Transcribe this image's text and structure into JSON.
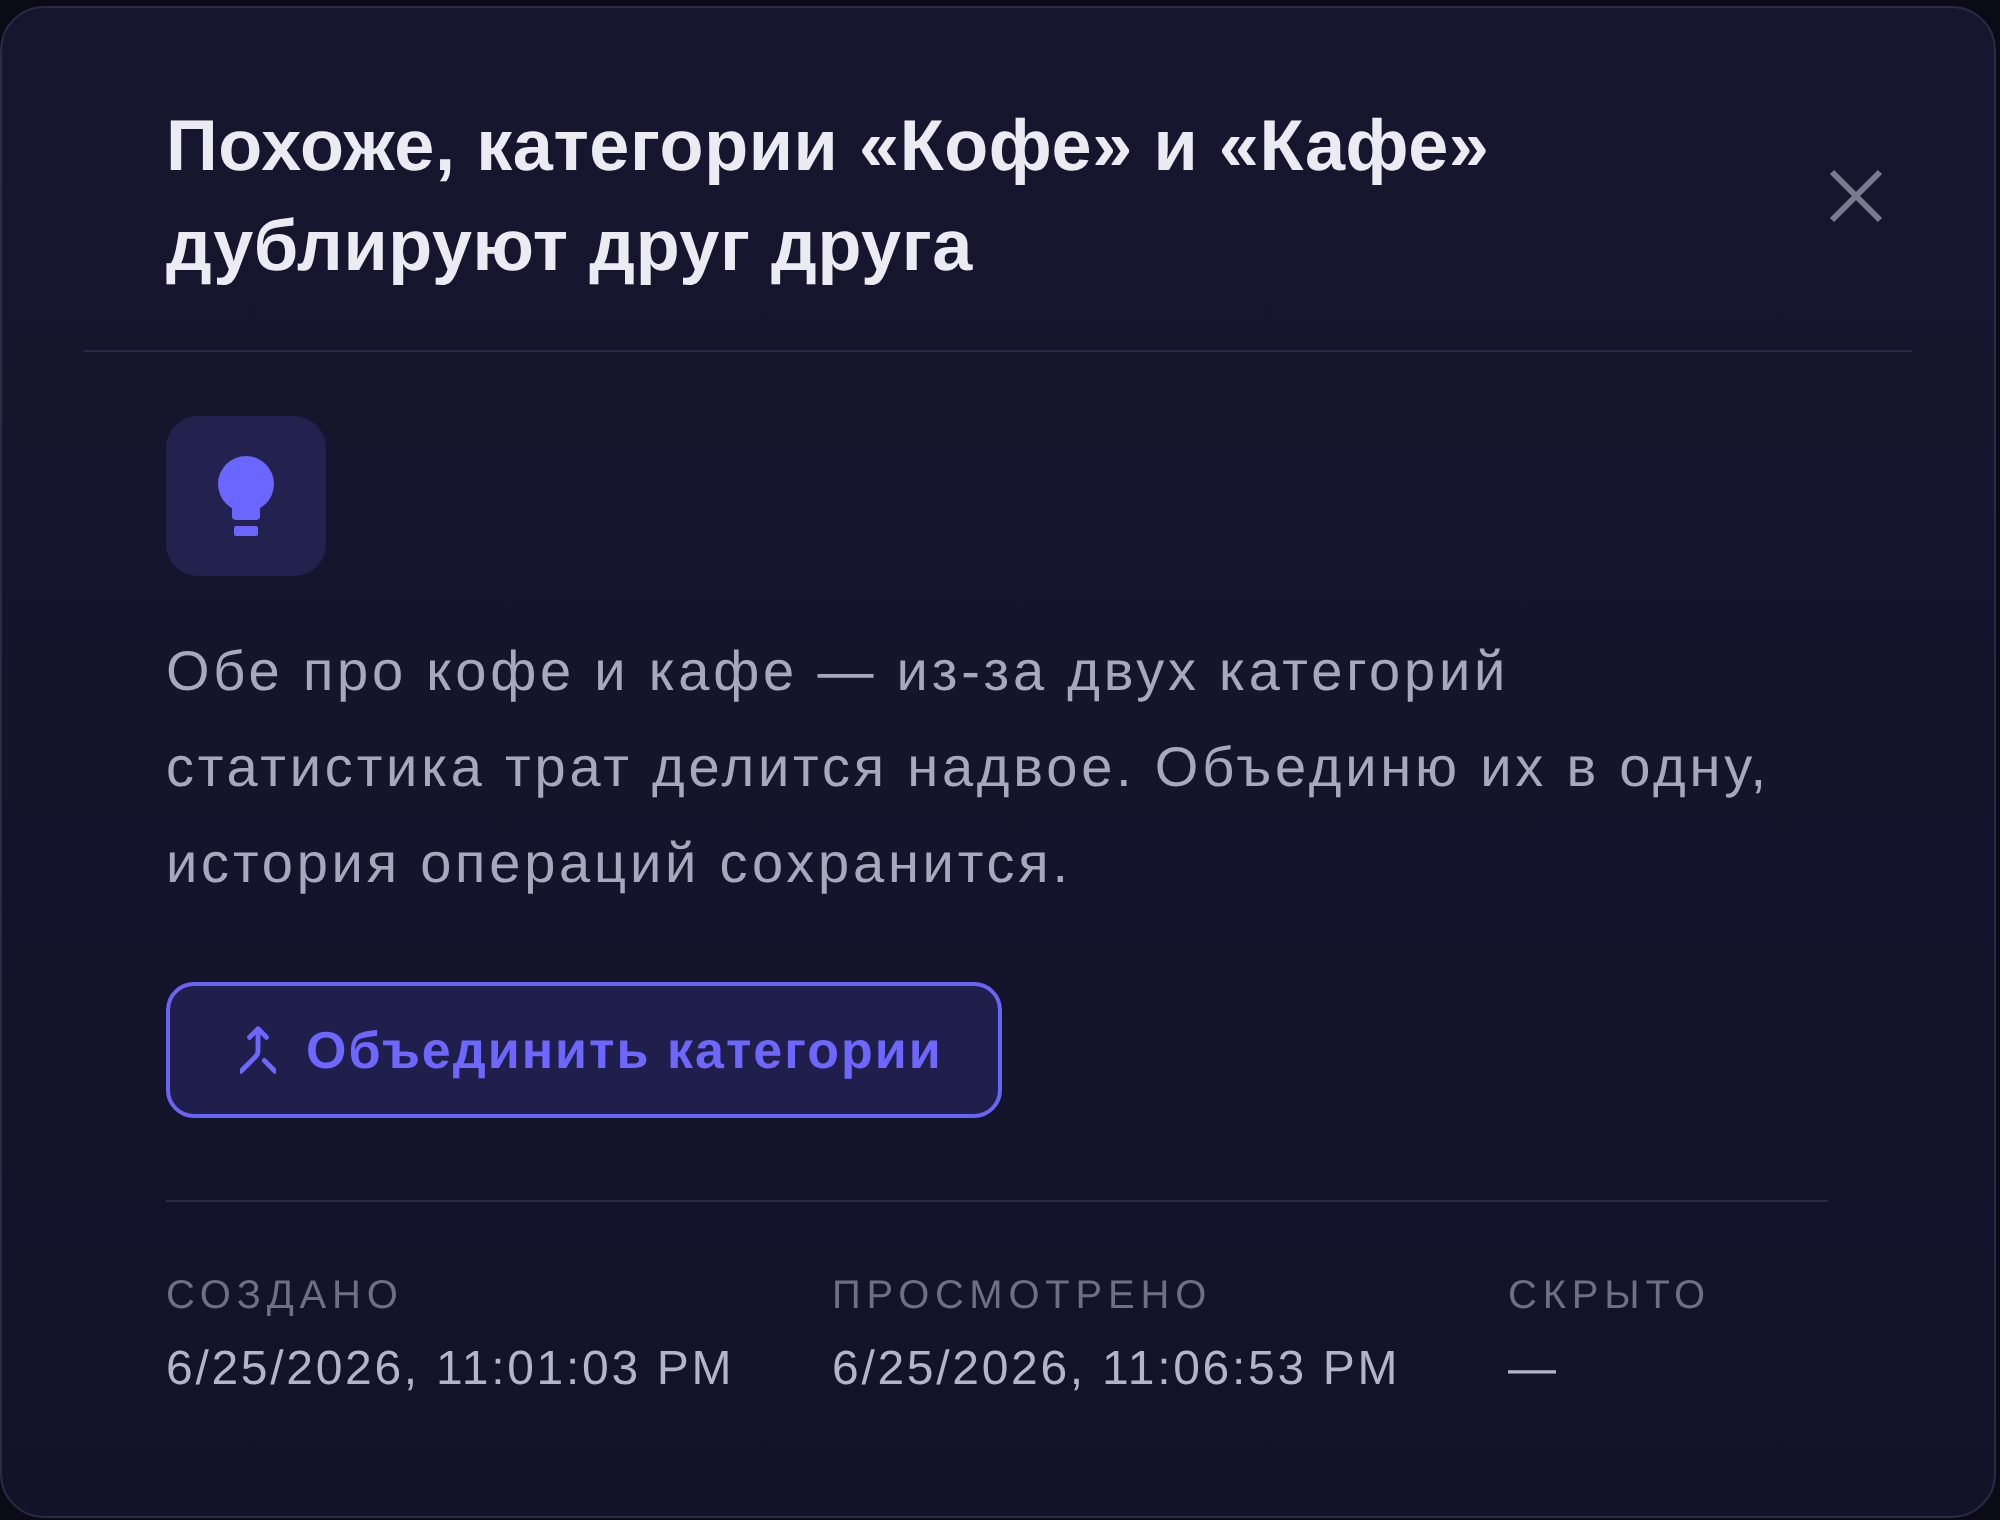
{
  "dialog": {
    "title": "Похоже, категории «Кофе» и «Кафе» дублируют друг друга",
    "description": "Обе про кофе и кафе — из-за двух категорий статистика трат делится надвое. Объединю их в одну, история операций сохранится.",
    "action": {
      "label": "Объединить категории"
    },
    "meta": [
      {
        "label": "СОЗДАНО",
        "value": "6/25/2026, 11:01:03 PM"
      },
      {
        "label": "ПРОСМОТРЕНО",
        "value": "6/25/2026, 11:06:53 PM"
      },
      {
        "label": "СКРЫТО",
        "value": "—"
      }
    ]
  }
}
